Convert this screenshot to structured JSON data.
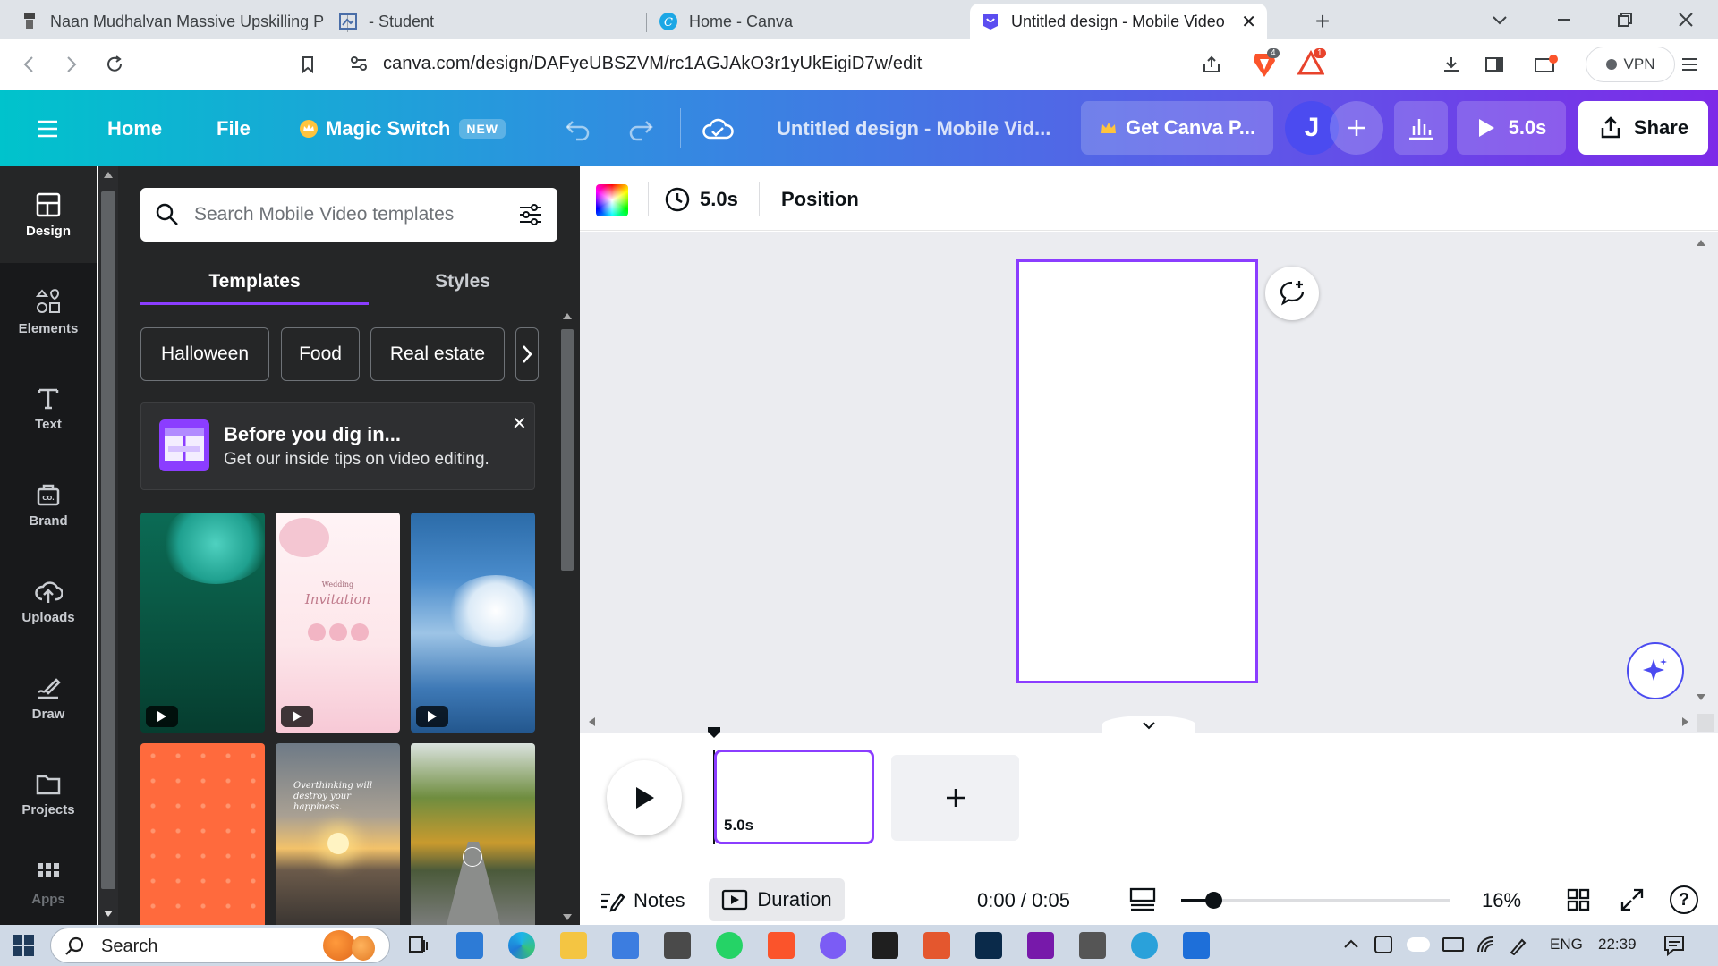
{
  "browser": {
    "tabs": [
      {
        "title": "Naan Mudhalvan Massive Upskilling P"
      },
      {
        "title": "- Student"
      },
      {
        "title": "Home - Canva"
      },
      {
        "title": "Untitled design - Mobile Video"
      }
    ],
    "url": "canva.com/design/DAFyeUBSZVM/rc1AGJAkO3r1yUkEigiD7w/edit",
    "vpn_label": "VPN",
    "brave_badge": "4",
    "rewards_badge": "1"
  },
  "header": {
    "home": "Home",
    "file": "File",
    "magic_switch": "Magic Switch",
    "new_badge": "NEW",
    "design_title": "Untitled design - Mobile Vid...",
    "get_pro": "Get Canva P...",
    "avatar_letter": "J",
    "play_time": "5.0s",
    "share": "Share"
  },
  "rail": {
    "items": [
      {
        "label": "Design"
      },
      {
        "label": "Elements"
      },
      {
        "label": "Text"
      },
      {
        "label": "Brand"
      },
      {
        "label": "Uploads"
      },
      {
        "label": "Draw"
      },
      {
        "label": "Projects"
      },
      {
        "label": "Apps"
      }
    ]
  },
  "panel": {
    "search_placeholder": "Search Mobile Video templates",
    "tabs": [
      "Templates",
      "Styles"
    ],
    "chips": [
      "Halloween",
      "Food",
      "Real estate"
    ],
    "tip": {
      "title": "Before you dig in...",
      "body": "Get our inside tips on video editing."
    },
    "templates": [
      {
        "type": "video"
      },
      {
        "type": "video",
        "small_text": "Wedding",
        "script_text": "Invitation"
      },
      {
        "type": "video"
      },
      {
        "type": "image"
      },
      {
        "type": "image",
        "quote": "Overthinking will destroy your happiness."
      },
      {
        "type": "image"
      }
    ]
  },
  "editor_toolbar": {
    "duration": "5.0s",
    "position": "Position"
  },
  "timeline": {
    "clip_duration": "5.0s"
  },
  "footer": {
    "notes": "Notes",
    "duration": "Duration",
    "timecode": "0:00 / 0:05",
    "zoom": "16%",
    "zoom_level": 0.12
  },
  "taskbar": {
    "search": "Search",
    "lang": "ENG",
    "time": "22:39"
  },
  "colors": {
    "accent": "#8b3dff",
    "header_start": "#00c3cc",
    "header_end": "#7d2ae8",
    "panel_bg": "#252627",
    "rail_bg": "#18191b"
  }
}
